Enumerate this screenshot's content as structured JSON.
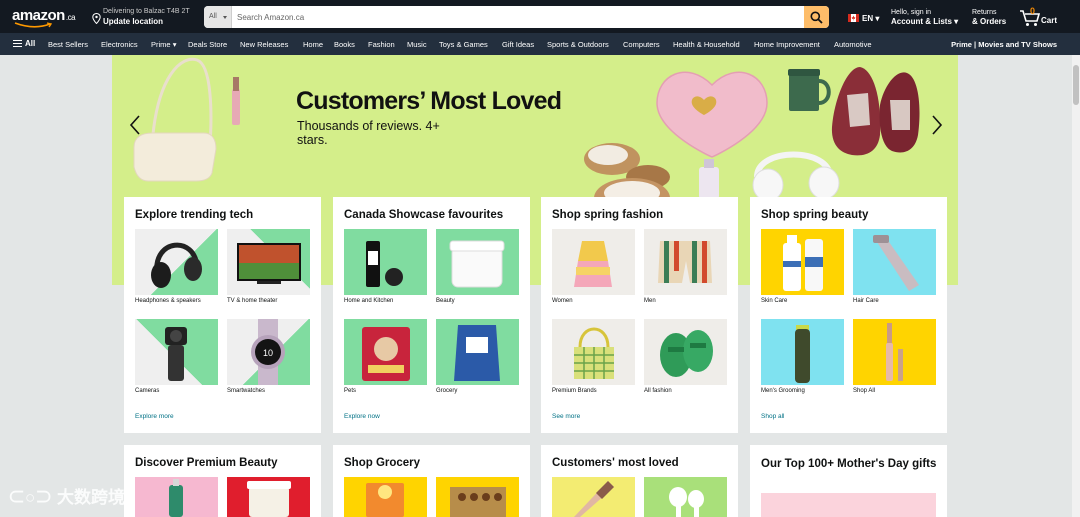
{
  "header": {
    "logo_text": "amazon",
    "logo_tld": ".ca",
    "deliver_line1": "Delivering to Balzac T4B 2T",
    "deliver_line2": "Update location",
    "search_category": "All",
    "search_placeholder": "Search Amazon.ca",
    "language": "EN",
    "account_line1": "Hello, sign in",
    "account_line2": "Account & Lists",
    "orders_line1": "Returns",
    "orders_line2": "& Orders",
    "cart_count": "0",
    "cart_label": "Cart"
  },
  "nav": {
    "all_label": "All",
    "items": [
      "Best Sellers",
      "Electronics",
      "Prime",
      "Deals Store",
      "New Releases",
      "Home",
      "Books",
      "Fashion",
      "Music",
      "Toys & Games",
      "Gift Ideas",
      "Sports & Outdoors",
      "Computers",
      "Health & Household",
      "Home Improvement",
      "Automotive"
    ],
    "right_label": "Prime | Movies and TV Shows"
  },
  "hero": {
    "title": "Customers’ Most Loved",
    "subtitle": "Thousands of reviews. 4+ stars."
  },
  "cards": [
    {
      "title": "Explore trending tech",
      "tiles": [
        "Headphones & speakers",
        "TV & home theater",
        "Cameras",
        "Smartwatches"
      ],
      "link": "Explore more"
    },
    {
      "title": "Canada Showcase favourites",
      "tiles": [
        "Home and Kitchen",
        "Beauty",
        "Pets",
        "Grocery"
      ],
      "link": "Explore now"
    },
    {
      "title": "Shop spring fashion",
      "tiles": [
        "Women",
        "Men",
        "Premium Brands",
        "All fashion"
      ],
      "link": "See more"
    },
    {
      "title": "Shop spring beauty",
      "tiles": [
        "Skin Care",
        "Hair Care",
        "Men's Grooming",
        "Shop All"
      ],
      "link": "Shop all"
    }
  ],
  "cards_row2": [
    {
      "title": "Discover Premium Beauty"
    },
    {
      "title": "Shop Grocery"
    },
    {
      "title": "Customers' most loved"
    },
    {
      "title": "Our Top 100+ Mother's Day gifts"
    }
  ],
  "watermark": "大数跨境",
  "colors": {
    "header_bg": "#131921",
    "nav_bg": "#232f3e",
    "search_button": "#febd69",
    "hero_bg": "#d4ee8a",
    "link": "#007185",
    "cart_count": "#f08804"
  }
}
